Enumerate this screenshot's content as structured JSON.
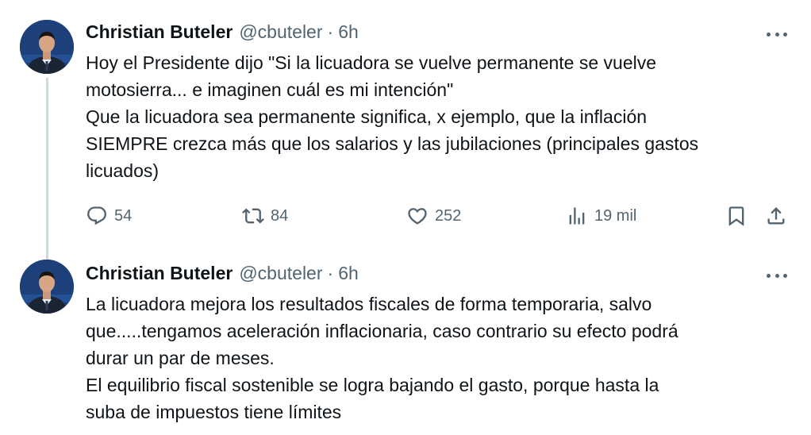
{
  "tweets": [
    {
      "author_name": "Christian Buteler",
      "handle": "@cbuteler",
      "separator": "·",
      "time": "6h",
      "lines": [
        "Hoy el Presidente dijo \"Si la licuadora se vuelve permanente se vuelve",
        "motosierra... e imaginen cuál es mi intención\"",
        "Que la licuadora sea permanente significa, x ejemplo, que la inflación",
        "SIEMPRE crezca más que los salarios y las jubilaciones (principales gastos",
        "licuados)"
      ],
      "replies": "54",
      "retweets": "84",
      "likes": "252",
      "views": "19 mil"
    },
    {
      "author_name": "Christian Buteler",
      "handle": "@cbuteler",
      "separator": "·",
      "time": "6h",
      "lines": [
        "La licuadora mejora los resultados fiscales de forma temporaria, salvo",
        "que.....tengamos aceleración inflacionaria, caso contrario su efecto podrá",
        "durar un par de meses.",
        "El equilibrio fiscal sostenible se logra bajando el gasto, porque hasta la",
        "suba de impuestos tiene límites"
      ]
    }
  ],
  "icons": {
    "reply": "speech-bubble-icon",
    "retweet": "retweet-icon",
    "like": "heart-icon",
    "views": "bar-chart-icon",
    "bookmark": "bookmark-icon",
    "share": "share-upload-icon",
    "more": "more-dots-icon"
  },
  "colors": {
    "text": "#0f1419",
    "secondary": "#536471",
    "thread_line": "#cfd9de",
    "background": "#ffffff"
  }
}
